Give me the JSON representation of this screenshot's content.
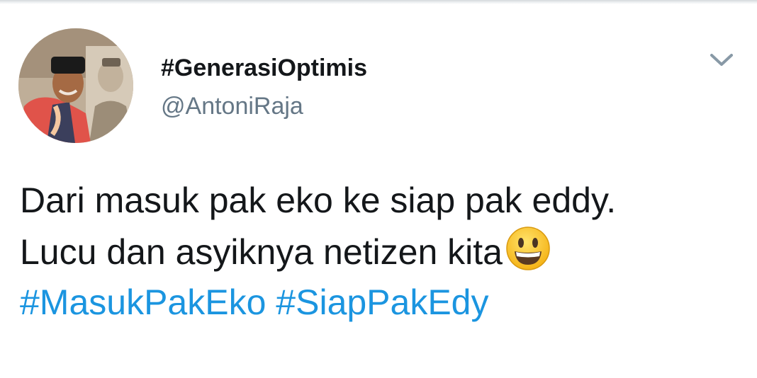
{
  "tweet": {
    "author": {
      "display_name": "#GenerasiOptimis",
      "handle": "@AntoniRaja",
      "avatar_icon": "profile-photo"
    },
    "menu_icon": "chevron-down-icon",
    "body": {
      "line1": "Dari masuk pak eko ke siap pak eddy.",
      "line2": "Lucu dan asyiknya netizen kita",
      "emoji": "grinning-face",
      "hashtag1": "#MasukPakEko",
      "hashtag2": "#SiapPakEdy"
    }
  },
  "colors": {
    "text": "#14171a",
    "secondary_text": "#657786",
    "link": "#1b95e0",
    "chevron": "#8899a6"
  }
}
